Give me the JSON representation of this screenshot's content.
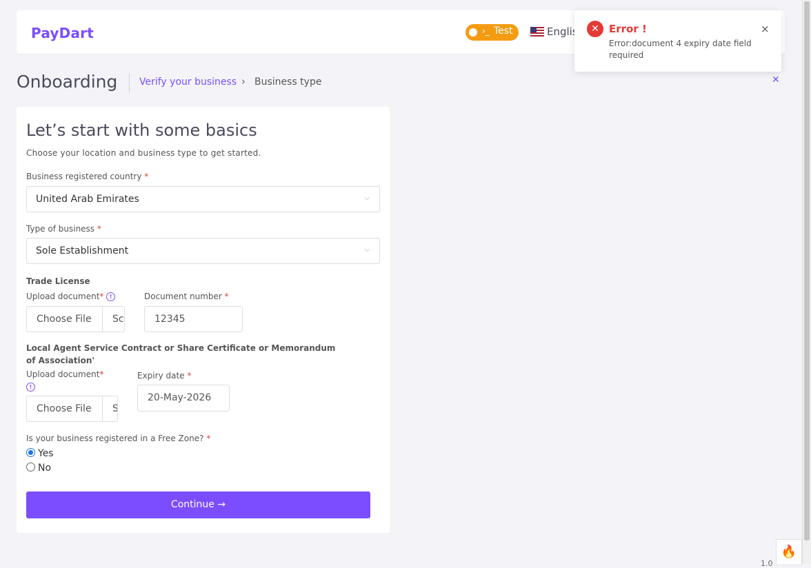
{
  "header": {
    "logo": "PayDart",
    "test_toggle_label": "Test",
    "test_toggle_glyph": "›_",
    "language": "English"
  },
  "breadcrumb": {
    "title": "Onboarding",
    "step1": "Verify your business",
    "step2": "Business type",
    "chevron": "›"
  },
  "form": {
    "heading": "Let’s start with some basics",
    "subheading": "Choose your location and business type to get started.",
    "country_label": "Business registered country",
    "country_value": "United Arab Emirates",
    "business_type_label": "Type of business",
    "business_type_value": "Sole Establishment",
    "trade_license_title": "Trade License",
    "upload_label": "Upload document",
    "choose_file": "Choose File",
    "file_status_1": "Sc",
    "file_status_2": "S",
    "doc_number_label": "Document number",
    "doc_number_value": "12345",
    "agent_section_title": "Local Agent Service Contract or Share Certificate or Memorandum of Association'",
    "upload_label_2": "Upload document",
    "expiry_label": "Expiry date",
    "expiry_value": "20-May-2026",
    "free_zone_question": "Is your business registered in a Free Zone?",
    "option_yes": "Yes",
    "option_no": "No",
    "free_zone_selected": "Yes",
    "continue_label": "Continue",
    "required_mark": "*"
  },
  "toast": {
    "title": "Error !",
    "message": "Error:document 4 expiry date field required",
    "close_glyph": "×"
  },
  "footer": {
    "version": "1.0"
  },
  "colors": {
    "accent": "#7c4dff",
    "test_toggle": "#f39c12",
    "error": "#e53935"
  }
}
